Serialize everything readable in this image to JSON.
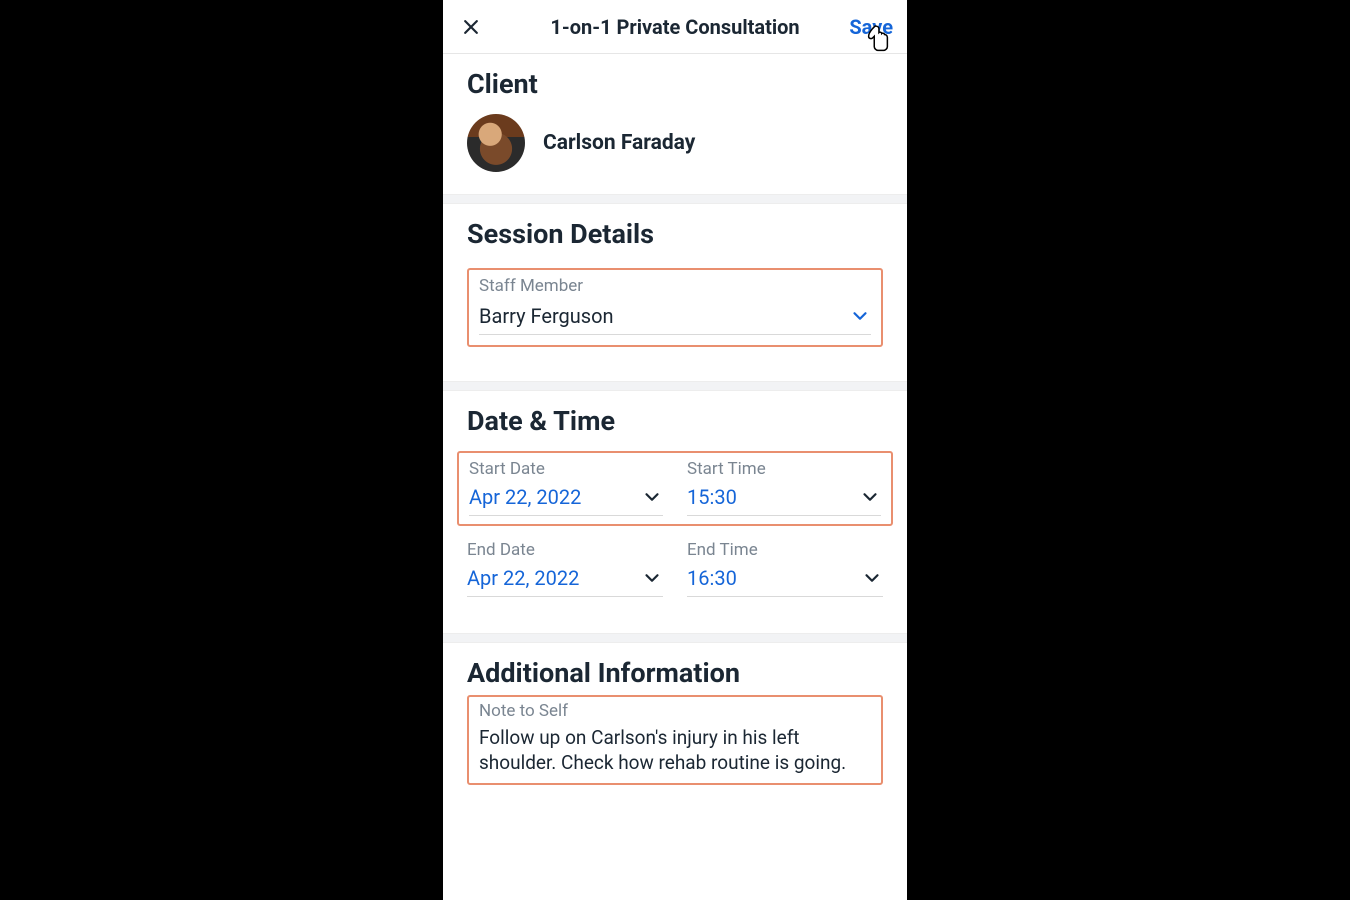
{
  "header": {
    "title": "1-on-1 Private Consultation",
    "save": "Save"
  },
  "client": {
    "heading": "Client",
    "name": "Carlson Faraday"
  },
  "session": {
    "heading": "Session Details",
    "staff_label": "Staff Member",
    "staff_value": "Barry Ferguson"
  },
  "datetime": {
    "heading": "Date & Time",
    "start_date_label": "Start Date",
    "start_date_value": "Apr 22, 2022",
    "start_time_label": "Start Time",
    "start_time_value": "15:30",
    "end_date_label": "End Date",
    "end_date_value": "Apr 22, 2022",
    "end_time_label": "End Time",
    "end_time_value": "16:30"
  },
  "additional": {
    "heading": "Additional Information",
    "note_label": "Note to Self",
    "note_value": "Follow up on Carlson's injury in his left shoulder. Check how rehab routine is going."
  }
}
